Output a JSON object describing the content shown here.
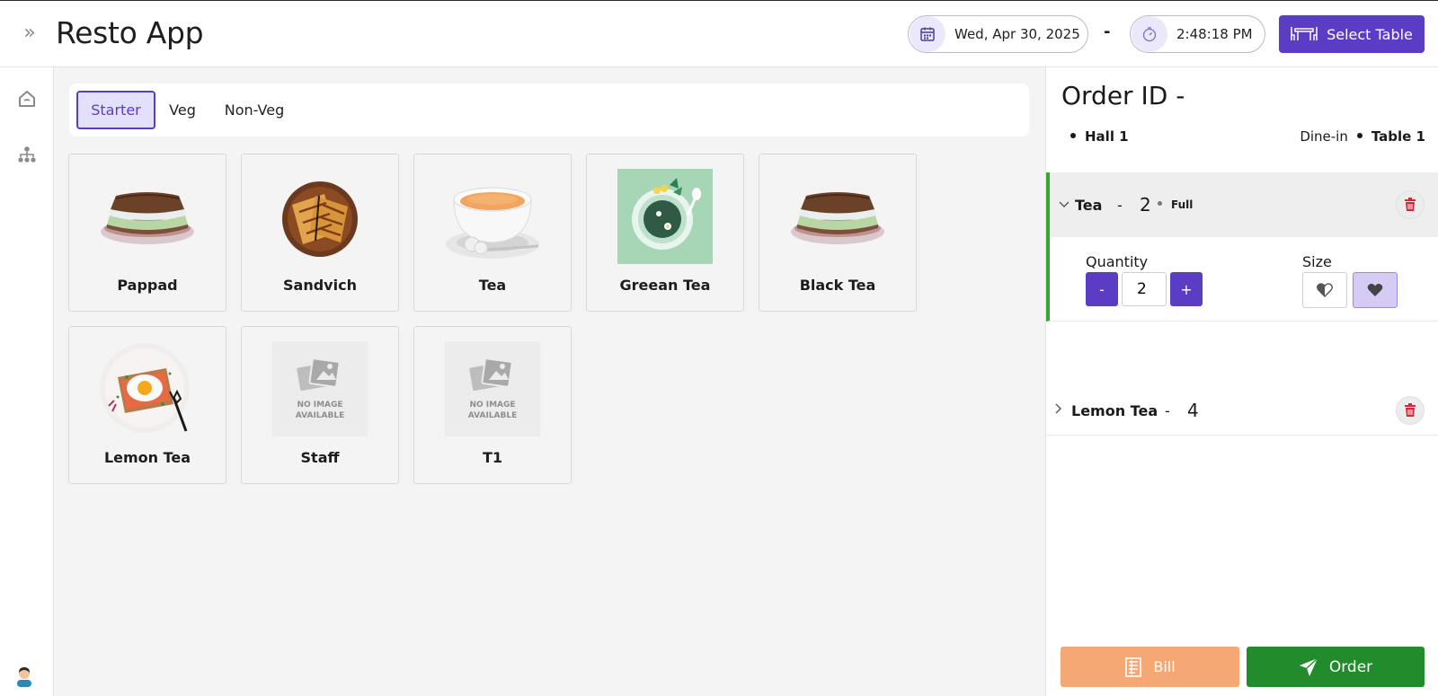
{
  "header": {
    "title": "Resto App",
    "date": "Wed, Apr 30, 2025",
    "separator": "-",
    "time": "2:48:18 PM",
    "select_table_label": "Select Table"
  },
  "sidebar": {
    "items": [
      {
        "icon": "home-icon"
      },
      {
        "icon": "hierarchy-icon"
      }
    ],
    "avatar_icon": "user-avatar-icon"
  },
  "menu": {
    "tabs": [
      {
        "label": "Starter",
        "active": true
      },
      {
        "label": "Veg",
        "active": false
      },
      {
        "label": "Non-Veg",
        "active": false
      }
    ],
    "items": [
      {
        "name": "Pappad",
        "image": "sandwich-photo"
      },
      {
        "name": "Sandvich",
        "image": "grilled-sandwich-photo"
      },
      {
        "name": "Tea",
        "image": "tea-cup-photo"
      },
      {
        "name": "Greean Tea",
        "image": "green-tea-illustration"
      },
      {
        "name": "Black Tea",
        "image": "sandwich-photo"
      },
      {
        "name": "Lemon Tea",
        "image": "egg-toast-photo"
      },
      {
        "name": "Staff",
        "image": "no-image"
      },
      {
        "name": "T1",
        "image": "no-image"
      }
    ],
    "no_image_text_line1": "NO IMAGE",
    "no_image_text_line2": "AVAILABLE"
  },
  "order": {
    "title": "Order ID -",
    "hall": "Hall 1",
    "service": "Dine-in",
    "table": "Table 1",
    "items": [
      {
        "name": "Tea",
        "dash": "-",
        "qty": "2",
        "size": "Full",
        "expanded": true
      },
      {
        "name": "Lemon Tea",
        "dash": "-",
        "qty": "4",
        "expanded": false
      }
    ],
    "quantity_label": "Quantity",
    "size_label": "Size",
    "quantity_value": "2",
    "minus_label": "-",
    "plus_label": "+",
    "bill_label": "Bill",
    "order_label": "Order"
  },
  "colors": {
    "accent": "#5b3cc4",
    "bill": "#f5a873",
    "order": "#228c2c",
    "delete": "#d6263a",
    "active_item_border": "#35a534"
  }
}
